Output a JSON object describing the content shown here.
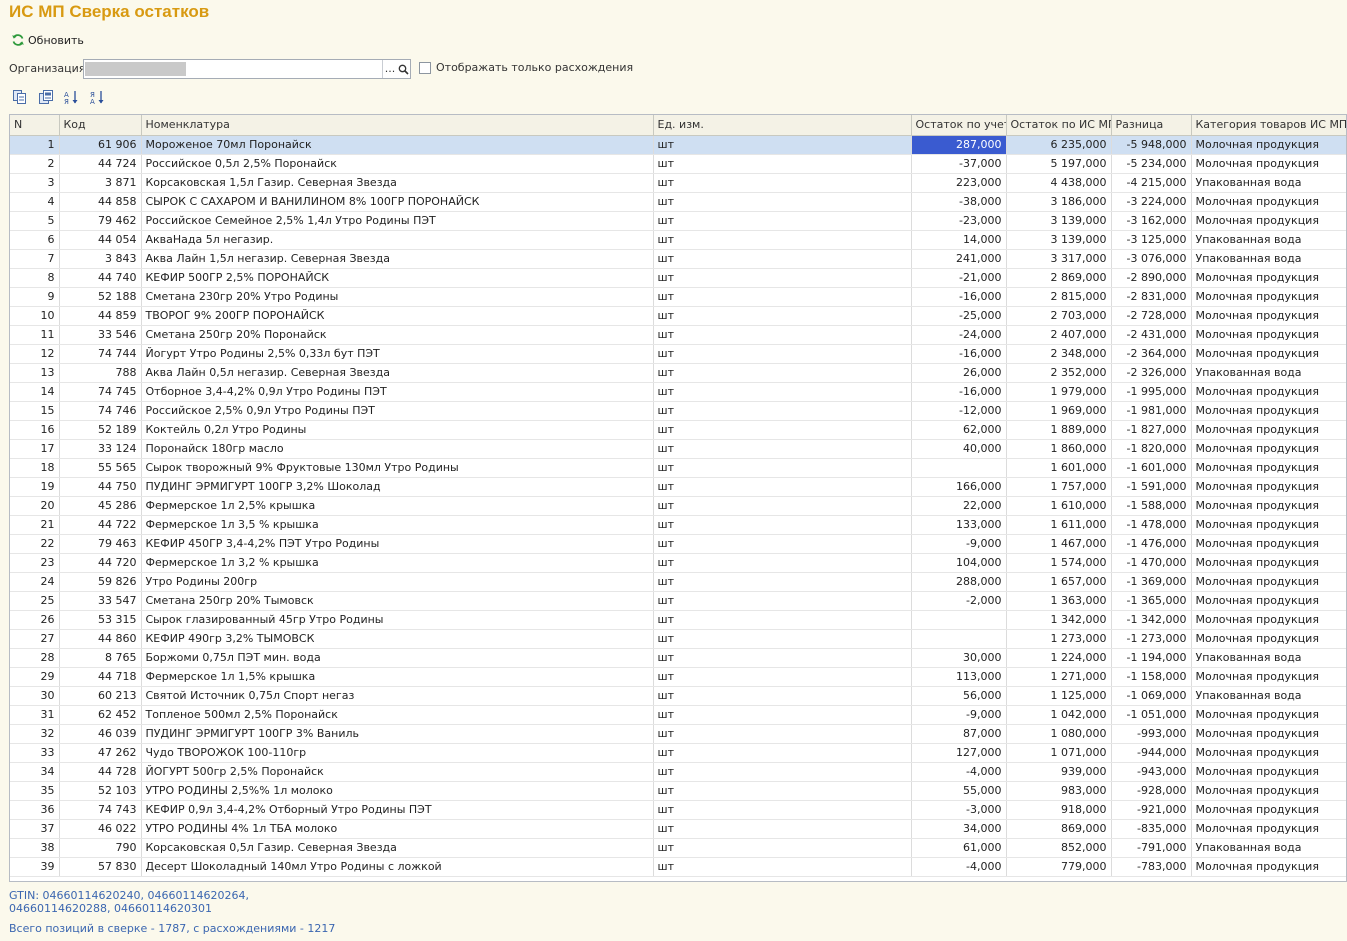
{
  "window": {
    "title": "ИС МП Сверка остатков"
  },
  "toolbar": {
    "refresh_label": "Обновить"
  },
  "filter": {
    "org_label": "Организация:",
    "org_value": "",
    "choose_label": "...",
    "only_diff_label": "Отображать только расхождения",
    "only_diff_checked": false
  },
  "icons": {
    "refresh": "refresh-icon",
    "search": "search-icon",
    "copy": "copy-icon",
    "copy_all": "copy-all-icon",
    "sort_asc": "sort-ascending-icon",
    "sort_desc": "sort-descending-icon"
  },
  "colors": {
    "title": "#d89a12",
    "selection": "#cfdff2",
    "current_cell": "#3a5bd0",
    "footer_text": "#3b66b0"
  },
  "table": {
    "columns": [
      "N",
      "Код",
      "Номенклатура",
      "Ед. изм.",
      "Остаток по учету",
      "Остаток по ИС МП",
      "Разница",
      "Категория товаров ИС МП"
    ],
    "selected_row": 0,
    "rows": [
      [
        "1",
        "61 906",
        "Мороженое 70мл Поронайск",
        "шт",
        "287,000",
        "6 235,000",
        "-5 948,000",
        "Молочная продукция"
      ],
      [
        "2",
        "44 724",
        "Российское 0,5л 2,5% Поронайск",
        "шт",
        "-37,000",
        "5 197,000",
        "-5 234,000",
        "Молочная продукция"
      ],
      [
        "3",
        "3 871",
        "Корсаковская 1,5л Газир. Северная Звезда",
        "шт",
        "223,000",
        "4 438,000",
        "-4 215,000",
        "Упакованная вода"
      ],
      [
        "4",
        "44 858",
        "СЫРОК С САХАРОМ И ВАНИЛИНОМ 8% 100ГР ПОРОНАЙСК",
        "шт",
        "-38,000",
        "3 186,000",
        "-3 224,000",
        "Молочная продукция"
      ],
      [
        "5",
        "79 462",
        "Российское Семейное 2,5% 1,4л Утро Родины ПЭТ",
        "шт",
        "-23,000",
        "3 139,000",
        "-3 162,000",
        "Молочная продукция"
      ],
      [
        "6",
        "44 054",
        "АкваНада 5л негазир.",
        "шт",
        "14,000",
        "3 139,000",
        "-3 125,000",
        "Упакованная вода"
      ],
      [
        "7",
        "3 843",
        "Аква Лайн 1,5л негазир. Северная Звезда",
        "шт",
        "241,000",
        "3 317,000",
        "-3 076,000",
        "Упакованная вода"
      ],
      [
        "8",
        "44 740",
        "КЕФИР 500ГР 2,5% ПОРОНАЙСК",
        "шт",
        "-21,000",
        "2 869,000",
        "-2 890,000",
        "Молочная продукция"
      ],
      [
        "9",
        "52 188",
        "Сметана 230гр  20% Утро Родины",
        "шт",
        "-16,000",
        "2 815,000",
        "-2 831,000",
        "Молочная продукция"
      ],
      [
        "10",
        "44 859",
        "ТВОРОГ 9% 200ГР ПОРОНАЙСК",
        "шт",
        "-25,000",
        "2 703,000",
        "-2 728,000",
        "Молочная продукция"
      ],
      [
        "11",
        "33 546",
        "Сметана 250гр  20% Поронайск",
        "шт",
        "-24,000",
        "2 407,000",
        "-2 431,000",
        "Молочная продукция"
      ],
      [
        "12",
        "74 744",
        "Йогурт Утро Родины  2,5% 0,33л  бут ПЭТ",
        "шт",
        "-16,000",
        "2 348,000",
        "-2 364,000",
        "Молочная продукция"
      ],
      [
        "13",
        "788",
        "Аква Лайн 0,5л негазир. Северная Звезда",
        "шт",
        "26,000",
        "2 352,000",
        "-2 326,000",
        "Упакованная вода"
      ],
      [
        "14",
        "74 745",
        "Отборное 3,4-4,2% 0,9л Утро Родины ПЭТ",
        "шт",
        "-16,000",
        "1 979,000",
        "-1 995,000",
        "Молочная продукция"
      ],
      [
        "15",
        "74 746",
        "Российское 2,5% 0,9л Утро Родины ПЭТ",
        "шт",
        "-12,000",
        "1 969,000",
        "-1 981,000",
        "Молочная продукция"
      ],
      [
        "16",
        "52 189",
        "Коктейль 0,2л Утро Родины",
        "шт",
        "62,000",
        "1 889,000",
        "-1 827,000",
        "Молочная продукция"
      ],
      [
        "17",
        "33 124",
        "Поронайск 180гр масло",
        "шт",
        "40,000",
        "1 860,000",
        "-1 820,000",
        "Молочная продукция"
      ],
      [
        "18",
        "55 565",
        "Сырок творожный 9% Фруктовые 130мл Утро Родины",
        "шт",
        "",
        "1 601,000",
        "-1 601,000",
        "Молочная продукция"
      ],
      [
        "19",
        "44 750",
        "ПУДИНГ ЭРМИГУРТ 100ГР 3,2% Шоколад",
        "шт",
        "166,000",
        "1 757,000",
        "-1 591,000",
        "Молочная продукция"
      ],
      [
        "20",
        "45 286",
        "Фермерское 1л 2,5% крышка",
        "шт",
        "22,000",
        "1 610,000",
        "-1 588,000",
        "Молочная продукция"
      ],
      [
        "21",
        "44 722",
        "Фермерское 1л 3,5 % крышка",
        "шт",
        "133,000",
        "1 611,000",
        "-1 478,000",
        "Молочная продукция"
      ],
      [
        "22",
        "79 463",
        "КЕФИР 450ГР 3,4-4,2% ПЭТ Утро Родины",
        "шт",
        "-9,000",
        "1 467,000",
        "-1 476,000",
        "Молочная продукция"
      ],
      [
        "23",
        "44 720",
        "Фермерское 1л 3,2 % крышка",
        "шт",
        "104,000",
        "1 574,000",
        "-1 470,000",
        "Молочная продукция"
      ],
      [
        "24",
        "59 826",
        "Утро Родины 200гр",
        "шт",
        "288,000",
        "1 657,000",
        "-1 369,000",
        "Молочная продукция"
      ],
      [
        "25",
        "33 547",
        "Сметана 250гр  20% Тымовск",
        "шт",
        "-2,000",
        "1 363,000",
        "-1 365,000",
        "Молочная продукция"
      ],
      [
        "26",
        "53 315",
        "Сырок глазированный 45гр Утро Родины",
        "шт",
        "",
        "1 342,000",
        "-1 342,000",
        "Молочная продукция"
      ],
      [
        "27",
        "44 860",
        "КЕФИР 490гр 3,2% ТЫМОВСК",
        "шт",
        "",
        "1 273,000",
        "-1 273,000",
        "Молочная продукция"
      ],
      [
        "28",
        "8 765",
        "Боржоми 0,75л ПЭТ мин. вода",
        "шт",
        "30,000",
        "1 224,000",
        "-1 194,000",
        "Упакованная вода"
      ],
      [
        "29",
        "44 718",
        "Фермерское 1л 1,5% крышка",
        "шт",
        "113,000",
        "1 271,000",
        "-1 158,000",
        "Молочная продукция"
      ],
      [
        "30",
        "60 213",
        "Святой Источник 0,75л Спорт негаз",
        "шт",
        "56,000",
        "1 125,000",
        "-1 069,000",
        "Упакованная вода"
      ],
      [
        "31",
        "62 452",
        "Топленое 500мл 2,5%  Поронайск",
        "шт",
        "-9,000",
        "1 042,000",
        "-1 051,000",
        "Молочная продукция"
      ],
      [
        "32",
        "46 039",
        "ПУДИНГ ЭРМИГУРТ 100ГР 3% Ваниль",
        "шт",
        "87,000",
        "1 080,000",
        "-993,000",
        "Молочная продукция"
      ],
      [
        "33",
        "47 262",
        "Чудо ТВОРОЖОК 100-110гр",
        "шт",
        "127,000",
        "1 071,000",
        "-944,000",
        "Молочная продукция"
      ],
      [
        "34",
        "44 728",
        "ЙОГУРТ 500гр 2,5%  Поронайск",
        "шт",
        "-4,000",
        "939,000",
        "-943,000",
        "Молочная продукция"
      ],
      [
        "35",
        "52 103",
        "УТРО РОДИНЫ 2,5%% 1л молоко",
        "шт",
        "55,000",
        "983,000",
        "-928,000",
        "Молочная продукция"
      ],
      [
        "36",
        "74 743",
        "КЕФИР 0,9л 3,4-4,2% Отборный Утро Родины ПЭТ",
        "шт",
        "-3,000",
        "918,000",
        "-921,000",
        "Молочная продукция"
      ],
      [
        "37",
        "46 022",
        "УТРО РОДИНЫ 4% 1л  ТБА молоко",
        "шт",
        "34,000",
        "869,000",
        "-835,000",
        "Молочная продукция"
      ],
      [
        "38",
        "790",
        "Корсаковская 0,5л Газир. Северная Звезда",
        "шт",
        "61,000",
        "852,000",
        "-791,000",
        "Упакованная вода"
      ],
      [
        "39",
        "57 830",
        "Десерт Шоколадный 140мл Утро Родины с ложкой",
        "шт",
        "-4,000",
        "779,000",
        "-783,000",
        "Молочная продукция"
      ]
    ]
  },
  "footer": {
    "gtin": "GTIN: 04660114620240, 04660114620264, 04660114620288, 04660114620301",
    "summary": "Всего позиций в сверке - 1787, с расхождениями - 1217"
  }
}
